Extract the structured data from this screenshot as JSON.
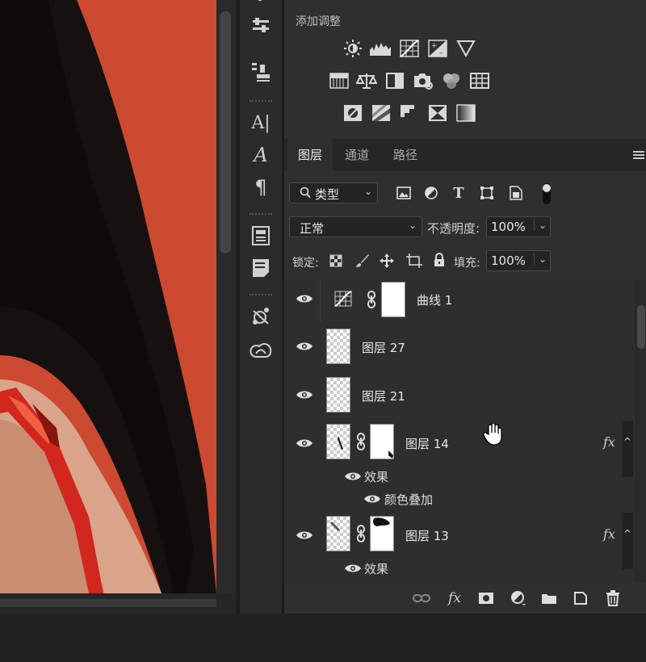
{
  "adjustments": {
    "title": "添加调整",
    "row1": [
      "brightness-icon",
      "levels-icon",
      "curves-icon",
      "exposure-icon",
      "vibrance-icon"
    ],
    "row2": [
      "hue-saturation-icon",
      "color-balance-icon",
      "black-white-icon",
      "photo-filter-icon",
      "channel-mixer-icon",
      "color-lookup-icon"
    ],
    "row3": [
      "invert-icon",
      "posterize-icon",
      "threshold-icon",
      "selective-color-icon",
      "gradient-map-icon"
    ]
  },
  "tabs": {
    "layers": "图层",
    "channels": "通道",
    "paths": "路径"
  },
  "filter": {
    "kind": "类型"
  },
  "blend": {
    "mode": "正常",
    "opacity_label": "不透明度:",
    "opacity": "100%"
  },
  "lock": {
    "label": "锁定:",
    "fill_label": "填充:",
    "fill": "100%"
  },
  "layers": [
    {
      "name": "曲线 1"
    },
    {
      "name": "图层 27"
    },
    {
      "name": "图层 21"
    },
    {
      "name": "图层 14",
      "effects_label": "效果",
      "effect": "颜色叠加",
      "fx": "fx"
    },
    {
      "name": "图层 13",
      "effects_label": "效果",
      "fx": "fx"
    }
  ],
  "colors": {
    "canvas_bg": "#cc4a32",
    "panel_bg": "#2f2f2f",
    "accent_text": "#e8e8e8"
  }
}
